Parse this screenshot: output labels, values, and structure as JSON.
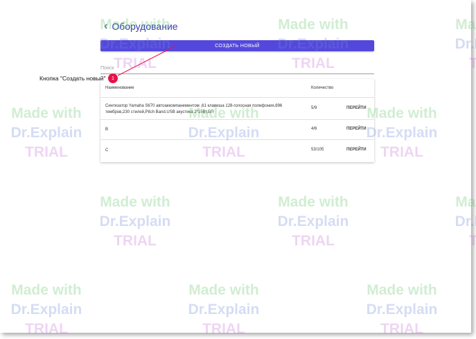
{
  "header": {
    "back_icon": "chevron-left-icon",
    "title": "Оборудование"
  },
  "create_button": {
    "label": "СОЗДАТЬ НОВЫЙ"
  },
  "search": {
    "placeholder": "Поиск"
  },
  "table": {
    "headers": {
      "name": "Наименование",
      "quantity": "Количество"
    },
    "rows": [
      {
        "name": "Синтезатор Yamaha S670 автоаккомпанементом ,61 клавиша 128-голосная полифония,896 тембров,230 стилей,Pitch Band.USB акустика 2*15Вт,БП",
        "quantity": "5/9",
        "action": "ПЕРЕЙТИ"
      },
      {
        "name": "B",
        "quantity": "4/6",
        "action": "ПЕРЕЙТИ"
      },
      {
        "name": "C",
        "quantity": "53/105",
        "action": "ПЕРЕЙТИ"
      }
    ]
  },
  "callout": {
    "label": "Кнопка \"Создать новый\"",
    "number": "1",
    "color": "#e8124a"
  },
  "watermark": {
    "line1": "Made with",
    "line2": "Dr.Explain",
    "line3": "TRIAL"
  },
  "colors": {
    "accent": "#5448dc",
    "title": "#3f3ab8"
  }
}
